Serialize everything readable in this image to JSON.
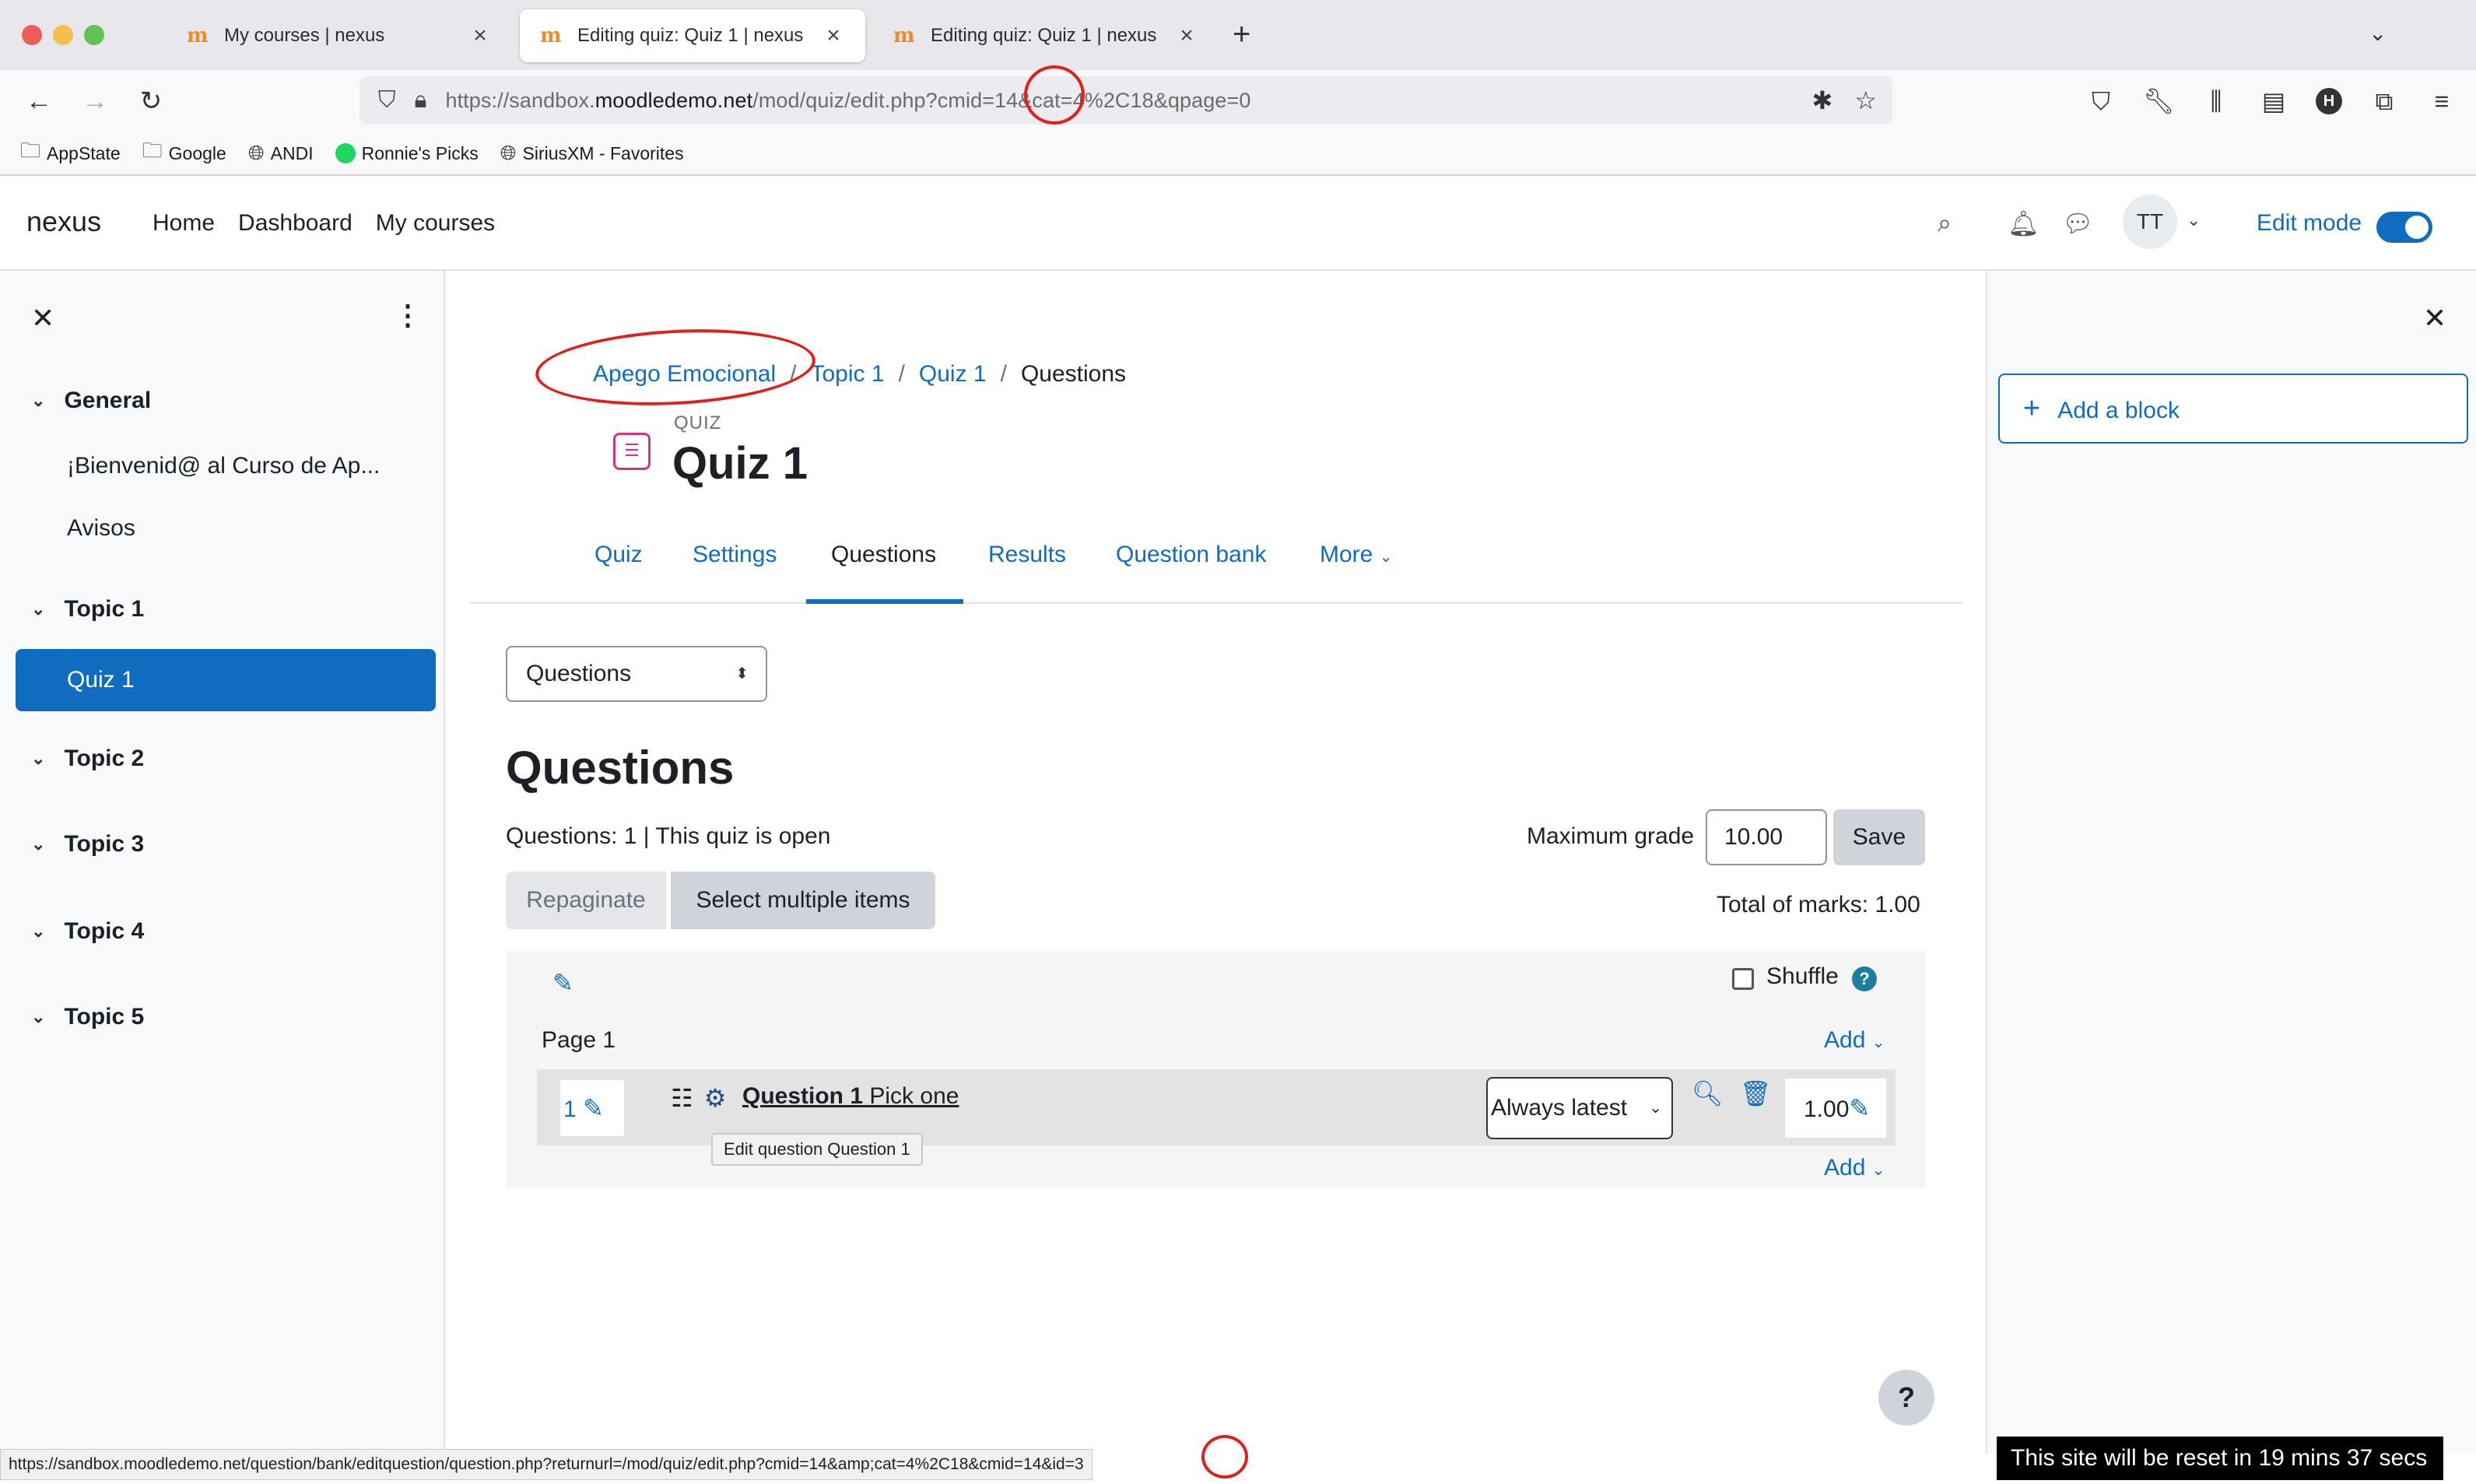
{
  "browser": {
    "tabs": [
      {
        "title": "My courses | nexus",
        "active": false
      },
      {
        "title": "Editing quiz: Quiz 1 | nexus",
        "active": true
      },
      {
        "title": "Editing quiz: Quiz 1 | nexus",
        "active": false
      }
    ],
    "url": {
      "prefix": "https://sandbox.",
      "domain": "moodledemo.net",
      "path": "/mod/quiz/edit.php?cmid=14&cat=4%2C18&qpage=0"
    },
    "bookmarks": [
      "AppState",
      "Google",
      "ANDI",
      "Ronnie's Picks",
      "SiriusXM - Favorites"
    ],
    "profile_initial": "H"
  },
  "header": {
    "brand": "nexus",
    "nav": [
      "Home",
      "Dashboard",
      "My courses"
    ],
    "avatar_initials": "TT",
    "edit_mode_label": "Edit mode",
    "edit_mode_on": true
  },
  "drawer": {
    "sections": [
      {
        "title": "General",
        "activities": [
          "¡Bienvenid@ al Curso de Ap...",
          "Avisos"
        ]
      },
      {
        "title": "Topic 1",
        "activities": [
          "Quiz 1"
        ]
      },
      {
        "title": "Topic 2",
        "activities": []
      },
      {
        "title": "Topic 3",
        "activities": []
      },
      {
        "title": "Topic 4",
        "activities": []
      },
      {
        "title": "Topic 5",
        "activities": []
      }
    ],
    "active_activity": "Quiz 1"
  },
  "breadcrumb": [
    "Apego Emocional",
    "Topic 1",
    "Quiz 1",
    "Questions"
  ],
  "activity": {
    "kicker": "QUIZ",
    "title": "Quiz 1"
  },
  "secondary_nav": {
    "tabs": [
      "Quiz",
      "Settings",
      "Questions",
      "Results",
      "Question bank",
      "More"
    ],
    "active": "Questions"
  },
  "page": {
    "select_value": "Questions",
    "heading": "Questions",
    "status": "Questions: 1 | This quiz is open",
    "max_grade_label": "Maximum grade",
    "max_grade_value": "10.00",
    "save_label": "Save",
    "repaginate_label": "Repaginate",
    "select_multiple_label": "Select multiple items",
    "total_marks": "Total of marks: 1.00",
    "shuffle_label": "Shuffle",
    "page_label": "Page 1",
    "add_label": "Add",
    "question": {
      "number": "1",
      "name": "Question 1",
      "text": "Pick one",
      "version": "Always latest",
      "mark": "1.00",
      "tooltip": "Edit question Question 1"
    }
  },
  "right_drawer": {
    "add_block_label": "Add a block"
  },
  "status_url": "https://sandbox.moodledemo.net/question/bank/editquestion/question.php?returnurl=/mod/quiz/edit.php?cmid=14&amp;cat=4%2C18&cmid=14&id=3",
  "reset_banner": "This site will be reset in 19 mins 37 secs",
  "colors": {
    "primary": "#0f6cbf",
    "annotation": "#e0211b",
    "quiz_icon": "#d63384"
  }
}
